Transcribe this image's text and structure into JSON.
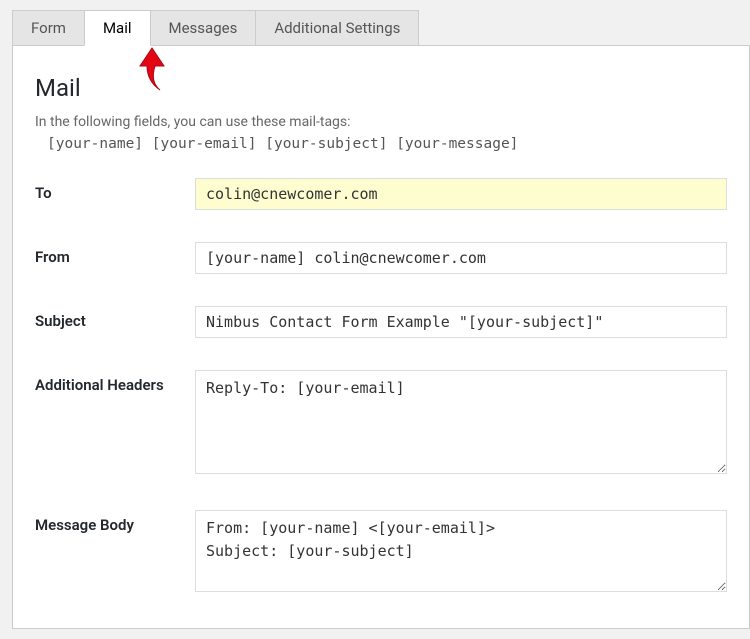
{
  "tabs": {
    "form": "Form",
    "mail": "Mail",
    "messages": "Messages",
    "additional": "Additional Settings"
  },
  "section": {
    "title": "Mail",
    "hint": "In the following fields, you can use these mail-tags:",
    "tags": "[your-name] [your-email] [your-subject] [your-message]"
  },
  "fields": {
    "to": {
      "label": "To",
      "value": "colin@cnewcomer.com"
    },
    "from": {
      "label": "From",
      "value": "[your-name] colin@cnewcomer.com"
    },
    "subject": {
      "label": "Subject",
      "value": "Nimbus Contact Form Example \"[your-subject]\""
    },
    "headers": {
      "label": "Additional Headers",
      "value": "Reply-To: [your-email]"
    },
    "body": {
      "label": "Message Body",
      "value": "From: [your-name] <[your-email]>\nSubject: [your-subject]"
    }
  }
}
